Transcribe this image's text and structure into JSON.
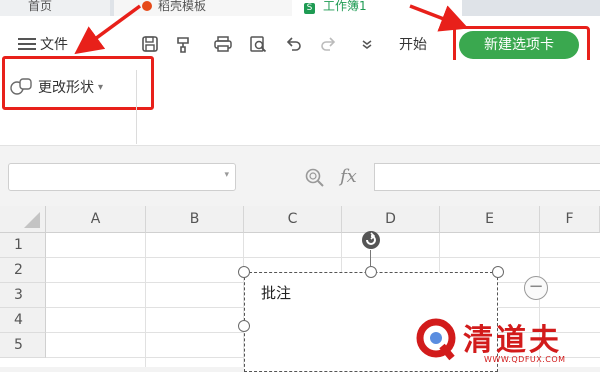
{
  "tabs": [
    {
      "label": "首页"
    },
    {
      "label": "稻壳模板"
    },
    {
      "label": "工作簿1",
      "icon_letter": "S"
    }
  ],
  "toolbar": {
    "file_label": "文件",
    "start_label": "开始",
    "new_tab_label": "新建选项卡",
    "quick_icons": [
      "save-icon",
      "format-painter-icon",
      "print-icon",
      "print-preview-icon",
      "undo-icon",
      "redo-icon",
      "more-icon"
    ]
  },
  "ribbon": {
    "change_shape_label": "更改形状",
    "change_shape_caret": "▾"
  },
  "formula_bar": {
    "fx_label": "fx"
  },
  "sheet": {
    "columns": [
      "A",
      "B",
      "C",
      "D",
      "E",
      "F"
    ],
    "rows": [
      "1",
      "2",
      "3",
      "4",
      "5"
    ]
  },
  "comment": {
    "text": "批注"
  },
  "watermark": {
    "text": "清道夫",
    "url": "WWW.QDFUX.COM"
  },
  "colors": {
    "accent_green": "#3aa84f",
    "highlight_red": "#e8201a",
    "watermark_red": "#d21b1b"
  }
}
